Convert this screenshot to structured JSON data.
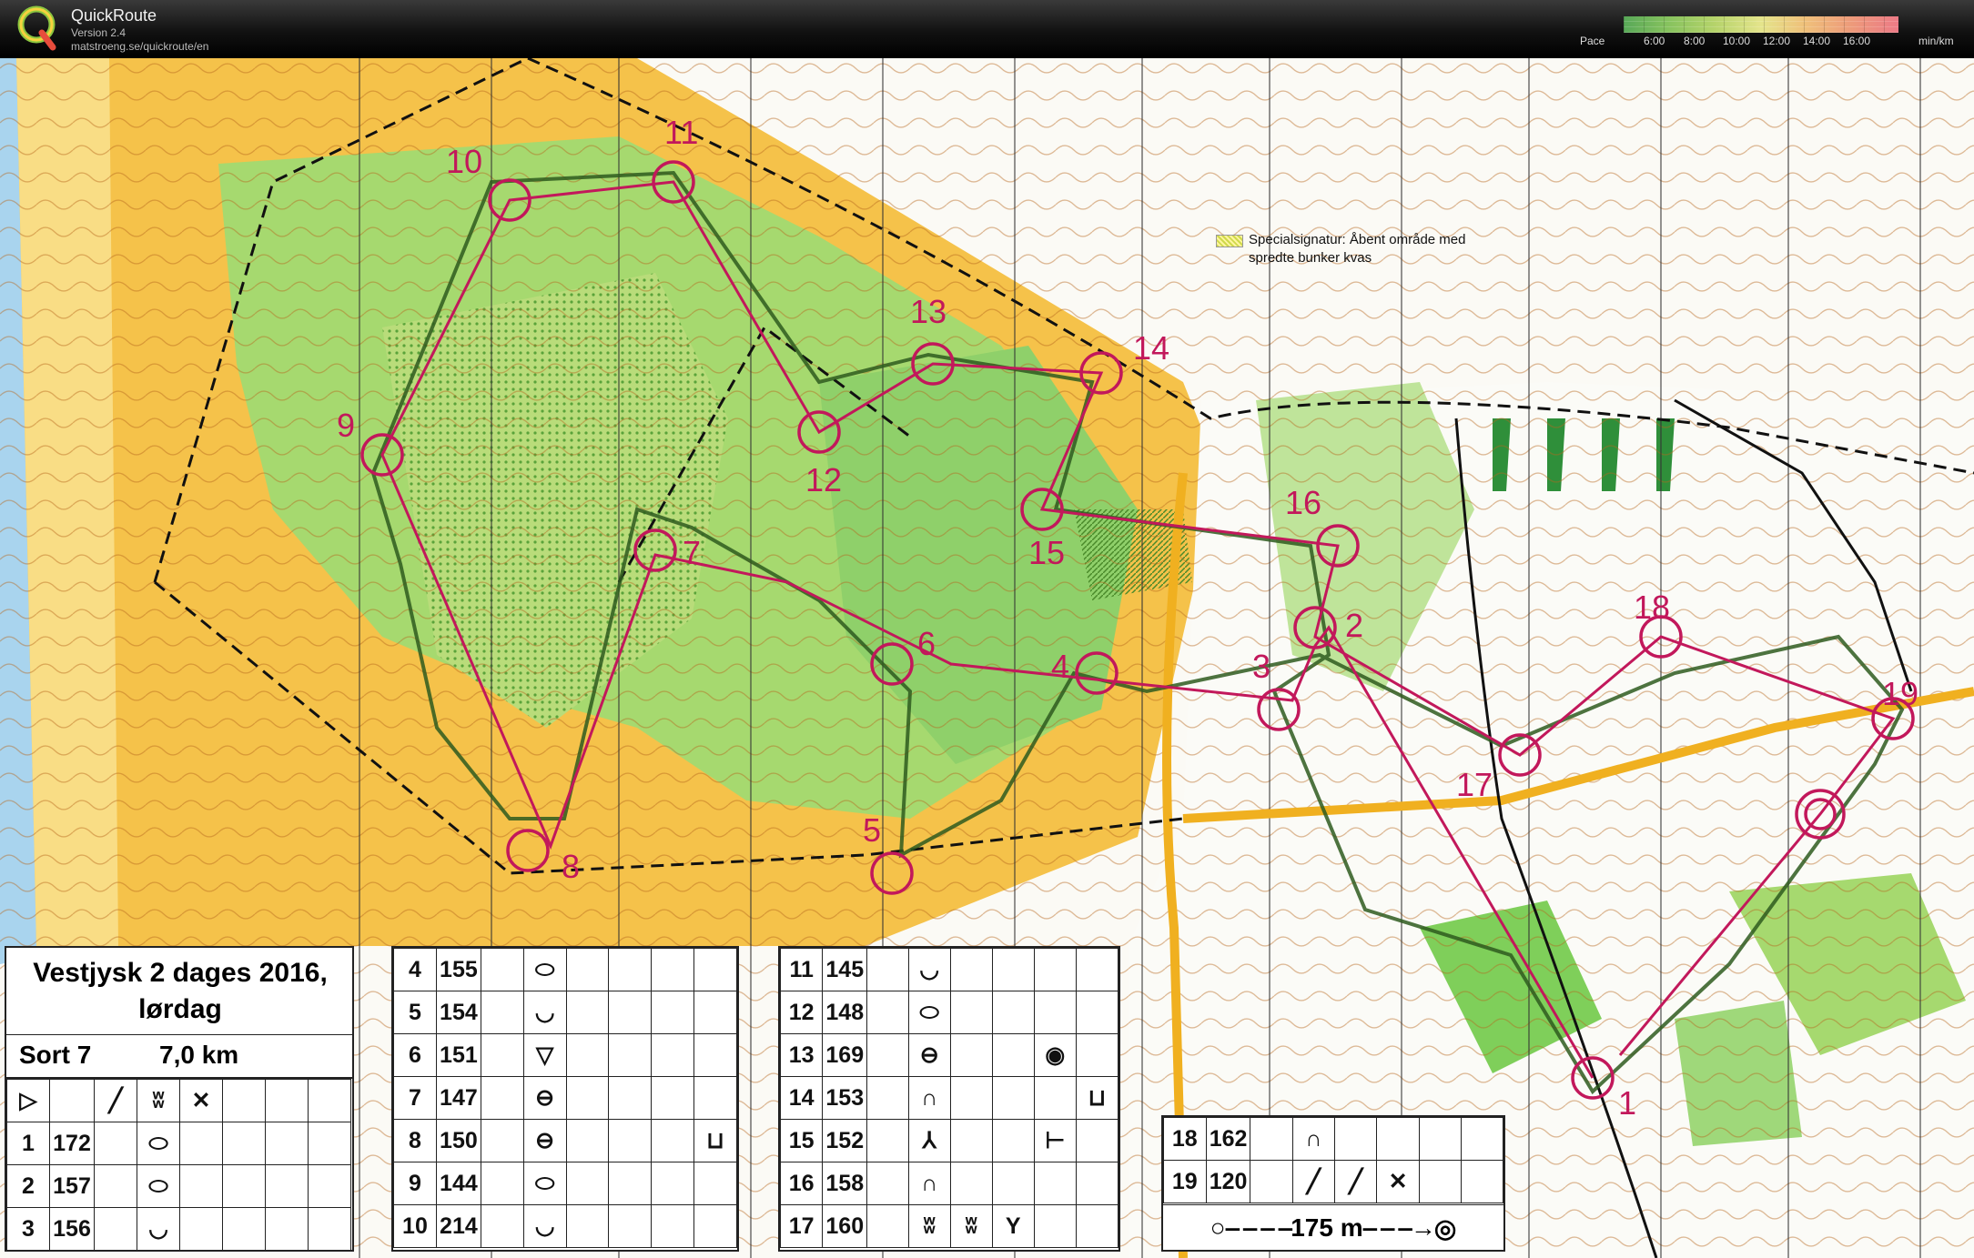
{
  "app": {
    "title": "QuickRoute",
    "version": "Version 2.4",
    "url": "matstroeng.se/quickroute/en",
    "pace_label": "Pace",
    "pace_ticks": [
      "6:00",
      "8:00",
      "10:00",
      "12:00",
      "14:00",
      "16:00"
    ],
    "pace_unit": "min/km"
  },
  "map": {
    "legend": [
      "Specialsignatur: Åbent område med",
      "spredte bunker kvas"
    ],
    "control_labels": [
      "1",
      "2",
      "3",
      "4",
      "5",
      "6",
      "7",
      "8",
      "9",
      "10",
      "11",
      "12",
      "13",
      "14",
      "15",
      "16",
      "17",
      "18",
      "19"
    ]
  },
  "description_sheet": {
    "title_line1": "Vestjysk 2 dages 2016,",
    "title_line2": "lørdag",
    "course_class": "Sort 7",
    "course_length": "7,0 km",
    "distance_to_finish": "175 m",
    "controls": [
      {
        "n": "1",
        "code": "172"
      },
      {
        "n": "2",
        "code": "157"
      },
      {
        "n": "3",
        "code": "156"
      },
      {
        "n": "4",
        "code": "155"
      },
      {
        "n": "5",
        "code": "154"
      },
      {
        "n": "6",
        "code": "151"
      },
      {
        "n": "7",
        "code": "147"
      },
      {
        "n": "8",
        "code": "150"
      },
      {
        "n": "9",
        "code": "144"
      },
      {
        "n": "10",
        "code": "214"
      },
      {
        "n": "11",
        "code": "145"
      },
      {
        "n": "12",
        "code": "148"
      },
      {
        "n": "13",
        "code": "169"
      },
      {
        "n": "14",
        "code": "153"
      },
      {
        "n": "15",
        "code": "152"
      },
      {
        "n": "16",
        "code": "158"
      },
      {
        "n": "17",
        "code": "160"
      },
      {
        "n": "18",
        "code": "162"
      },
      {
        "n": "19",
        "code": "120"
      }
    ]
  },
  "colors": {
    "course": "#c2185b",
    "route": "#2e5b1e",
    "open_land": "#f5c24a",
    "forest": "#8fd06a",
    "water": "#a9d4ee"
  }
}
